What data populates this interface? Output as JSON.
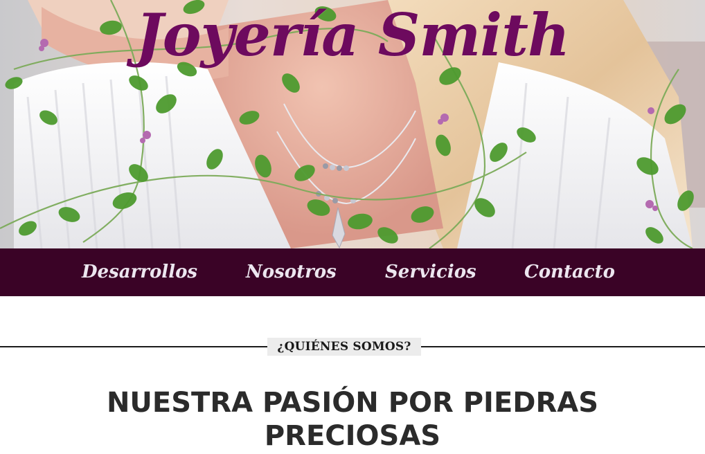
{
  "brand": {
    "title": "Joyería Smith"
  },
  "nav": {
    "items": [
      {
        "label": "Desarrollos"
      },
      {
        "label": "Nosotros"
      },
      {
        "label": "Servicios"
      },
      {
        "label": "Contacto"
      }
    ]
  },
  "about": {
    "section_label": "¿QUIÉNES SOMOS?",
    "heading": "NUESTRA PASIÓN POR PIEDRAS",
    "heading_line2": "PRECIOSAS"
  },
  "colors": {
    "title": "#6d0a5e",
    "nav_background": "#3a0326",
    "nav_text": "#ece6ef",
    "label_background": "#ececec",
    "heading_text": "#2b2b2b"
  },
  "icons": {
    "hero": "woman-with-necklace-photo",
    "decor": "vine-leaves-decoration"
  }
}
